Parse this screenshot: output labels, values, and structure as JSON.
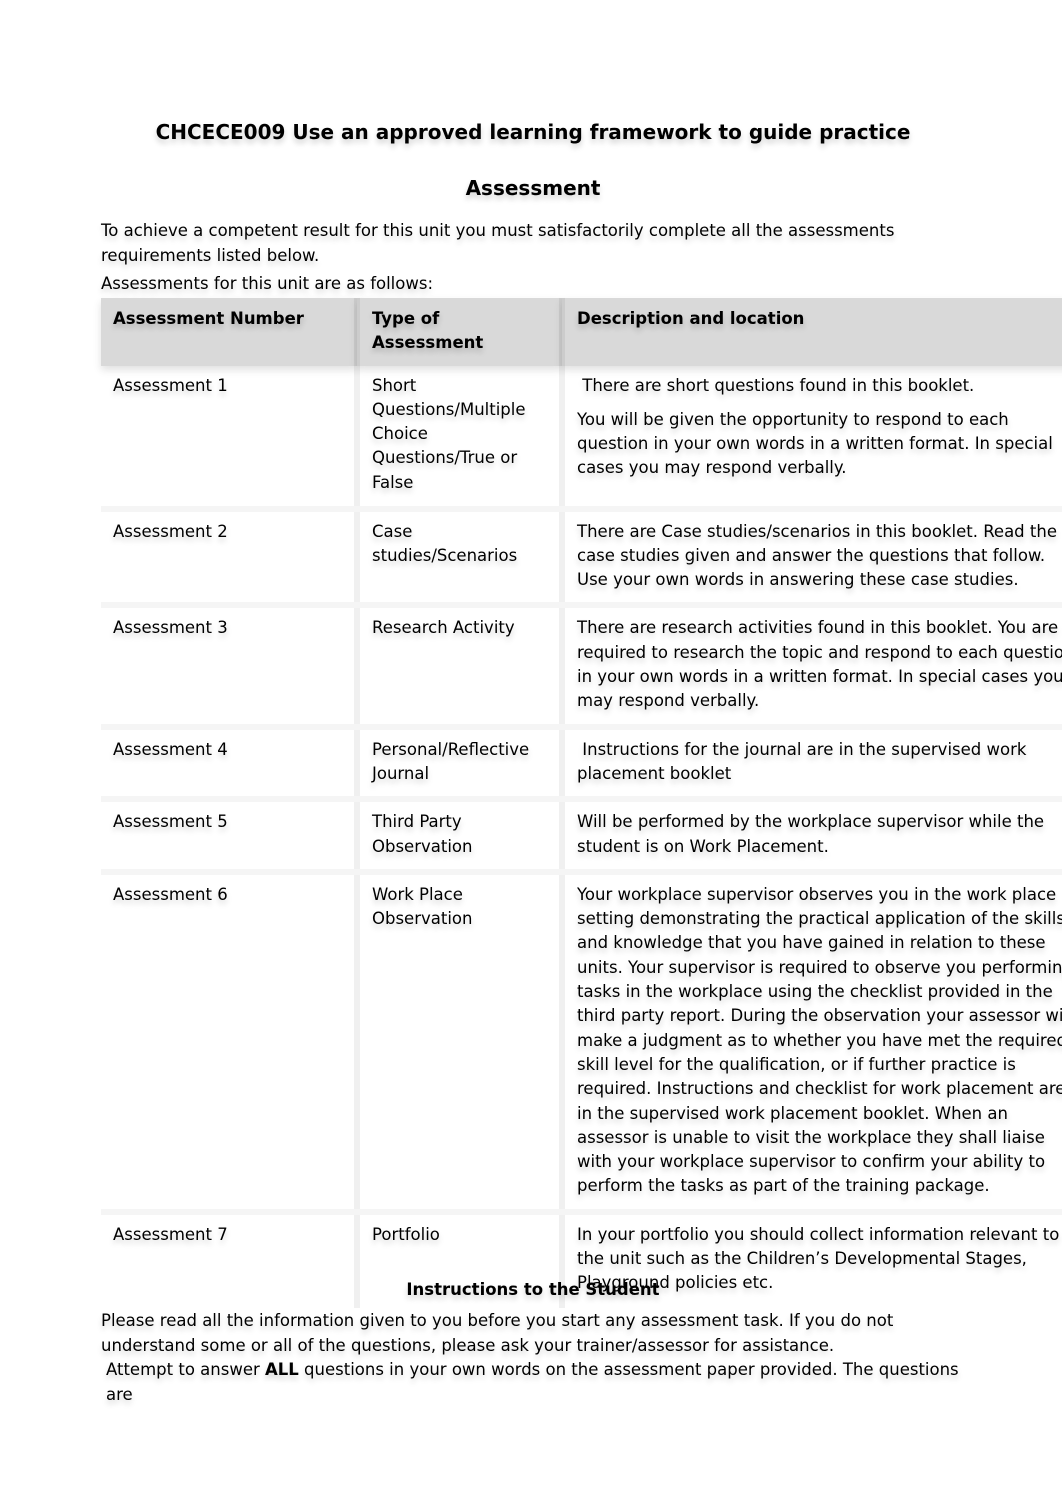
{
  "document": {
    "title": "CHCECE009 Use an approved learning framework to guide practice",
    "subtitle": "Assessment",
    "intro": "To achieve a competent result for this unit you must satisfactorily complete all the assessments requirements listed below.",
    "list_intro": "Assessments for this unit are as follows:"
  },
  "table": {
    "headers": [
      "Assessment Number",
      "Type of Assessment",
      "Description and location"
    ],
    "rows": [
      {
        "number": "Assessment 1",
        "type": "Short Questions/Multiple Choice Questions/True or False",
        "description": [
          " There are short questions found in this booklet.",
          "You will be given the opportunity to respond to each question in your own words in a written format.  In special cases you may respond verbally."
        ]
      },
      {
        "number": "Assessment 2",
        "type": "Case studies/Scenarios",
        "description": [
          "There are Case studies/scenarios in this booklet. Read the case studies given and answer the questions that follow. Use your own words in answering these case studies."
        ]
      },
      {
        "number": "Assessment 3",
        "type": "Research Activity",
        "description": [
          "There are research activities found in this booklet. You are required to research the topic and respond to each question in your own words in a written format. In special cases you may respond verbally."
        ]
      },
      {
        "number": "Assessment 4",
        "type": "Personal/Reflective Journal",
        "description": [
          " Instructions for the journal are in the supervised work placement booklet"
        ]
      },
      {
        "number": "Assessment 5",
        "type": "Third Party Observation",
        "description": [
          "Will be performed by the workplace supervisor while the student is on Work Placement."
        ]
      },
      {
        "number": "Assessment 6",
        "type": "Work Place Observation",
        "description": [
          "Your workplace supervisor observes you in the work place setting demonstrating the practical application of the skills and knowledge that you have gained in relation to these units.  Your supervisor is required to observe you performing tasks in the workplace using the checklist provided in the third party report. During the observation your assessor will make a judgment as to whether you have met the required skill level for the qualification, or if further practice is required. Instructions and checklist for work placement are in the supervised work placement booklet. When an assessor is unable to visit the workplace they shall liaise with your workplace supervisor to confirm your ability to perform the tasks as part of the training package."
        ]
      },
      {
        "number": "Assessment 7",
        "type": "Portfolio",
        "description": [
          "In your portfolio you should collect information relevant to the unit such as the Children’s  Developmental Stages, Playground policies etc."
        ]
      }
    ]
  },
  "instructions": {
    "heading": "Instructions to the Student",
    "paragraph1": "Please read all the information given to you before you start any assessment task. If you do not understand some or all of the questions, please ask your trainer/assessor for assistance.",
    "paragraph2_before": "Attempt to answer ",
    "paragraph2_bold": "ALL",
    "paragraph2_after": " questions in your own words on the assessment paper provided. The questions are"
  }
}
